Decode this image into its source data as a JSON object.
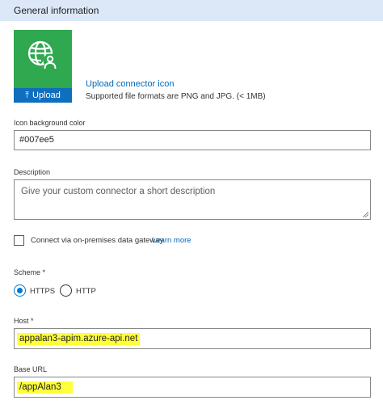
{
  "header": {
    "title": "General information"
  },
  "icon_panel": {
    "background_color": "#2fa84f",
    "upload_label": "Upload",
    "upload_link": "Upload connector icon",
    "formats_note": "Supported file formats are PNG and JPG. (< 1MB)"
  },
  "icon_bg": {
    "label": "Icon background color",
    "value": "#007ee5"
  },
  "description": {
    "label": "Description",
    "placeholder": "Give your custom connector a short description"
  },
  "gateway": {
    "label": "Connect via on-premises data gateway",
    "link": "Learn more",
    "checked": false
  },
  "scheme": {
    "label": "Scheme",
    "required_mark": "*",
    "options": [
      "HTTPS",
      "HTTP"
    ],
    "selected": "HTTPS"
  },
  "host": {
    "label": "Host",
    "required_mark": "*",
    "value": "appalan3-apim.azure-api.net"
  },
  "base_url": {
    "label": "Base URL",
    "value": "/appAlan3"
  },
  "colors": {
    "accent": "#0078d4",
    "link": "#0067b8",
    "header_bg": "#dce8f8",
    "highlight": "#ffff3c",
    "upload_bar": "#106ebe"
  }
}
